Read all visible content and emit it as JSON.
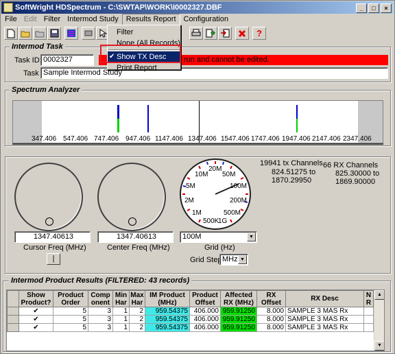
{
  "window": {
    "title": "SoftWright HDSpectrum - C:\\SWTAP\\WORK\\I0002327.DBF",
    "btn_min": "_",
    "btn_max": "□",
    "btn_close": "×"
  },
  "menubar": {
    "items": [
      "File",
      "Edit",
      "Filter",
      "Intermod Study",
      "Results Report",
      "Configuration"
    ]
  },
  "dropdown": {
    "items": [
      "Filter",
      "None (All Records)",
      "Show TX Desc",
      "Print Report"
    ],
    "checked_index": 2,
    "check": "✔"
  },
  "intermod_task": {
    "title": "Intermod Task",
    "task_id_label": "Task ID:",
    "task_id_value": "0002327",
    "warning": "run and cannot be edited.",
    "task_label": "Task",
    "task_value": "Sample Intermod Study"
  },
  "spectrum": {
    "title": "Spectrum Analyzer",
    "ticks": [
      "347.406",
      "547.406",
      "747.406",
      "947.406",
      "1147.406",
      "1347.406",
      "1547.406",
      "1747.406",
      "1947.406",
      "2147.406",
      "2347.406"
    ]
  },
  "controls": {
    "cursor_freq_value": "1347.40613",
    "cursor_freq_label": "Cursor Freq (MHz)",
    "cursor_btn": "|",
    "center_freq_value": "1347.40613",
    "center_freq_label": "Center Freq (MHz)",
    "grid_value": "100M",
    "grid_label": "Grid (Hz)",
    "grid_step_label": "Grid Step",
    "grid_step_value": "MHz",
    "dial_labels": [
      "20M",
      "10M",
      "50M",
      "5M",
      "100M",
      "2M",
      "200M",
      "1M",
      "500M",
      "500K",
      "1G"
    ],
    "tx_channels": "19941 tx Channels",
    "tx_range_a": "824.51275 to",
    "tx_range_b": "1870.29950",
    "rx_channels": "66 RX Channels",
    "rx_range_a": "825.30000 to",
    "rx_range_b": "1869.90000"
  },
  "results": {
    "title": "Intermod Product Results (FILTERED: 43 records)",
    "headers": [
      "Show Product?",
      "Product Order",
      "Component",
      "Min Har",
      "Max Har",
      "IM Product (MHz)",
      "Product Offset",
      "Affected RX (MHz)",
      "RX Offset",
      "RX Desc",
      "N R"
    ],
    "header_lines": [
      [
        "Show",
        "Product?"
      ],
      [
        "Product",
        "Order"
      ],
      [
        "Comp",
        "onent"
      ],
      [
        "Min",
        "Har"
      ],
      [
        "Max",
        "Har"
      ],
      [
        "IM Product",
        "(MHz)"
      ],
      [
        "Product",
        "Offset"
      ],
      [
        "Affected",
        "RX (MHz)"
      ],
      [
        "RX",
        "Offset"
      ],
      [
        "RX Desc",
        ""
      ],
      [
        "N",
        "R"
      ]
    ],
    "rows": [
      {
        "show": "✔",
        "order": "5",
        "component": "3",
        "min": "1",
        "max": "2",
        "im": "959.54375",
        "offset": "406.000",
        "rx": "959.91250",
        "rxoff": "8.000",
        "desc": "SAMPLE 3 MAS Rx"
      },
      {
        "show": "✔",
        "order": "5",
        "component": "3",
        "min": "1",
        "max": "2",
        "im": "959.54375",
        "offset": "406.000",
        "rx": "959.91250",
        "rxoff": "8.000",
        "desc": "SAMPLE 3 MAS Rx"
      },
      {
        "show": "✔",
        "order": "5",
        "component": "3",
        "min": "1",
        "max": "2",
        "im": "959.54375",
        "offset": "406.000",
        "rx": "959.91250",
        "rxoff": "8.000",
        "desc": "SAMPLE 3 MAS Rx"
      }
    ]
  },
  "colors": {
    "im_cell": "#40e8e8",
    "rx_cell": "#00e000",
    "warning": "#ff0000",
    "highlight_box": "#e31b23"
  }
}
